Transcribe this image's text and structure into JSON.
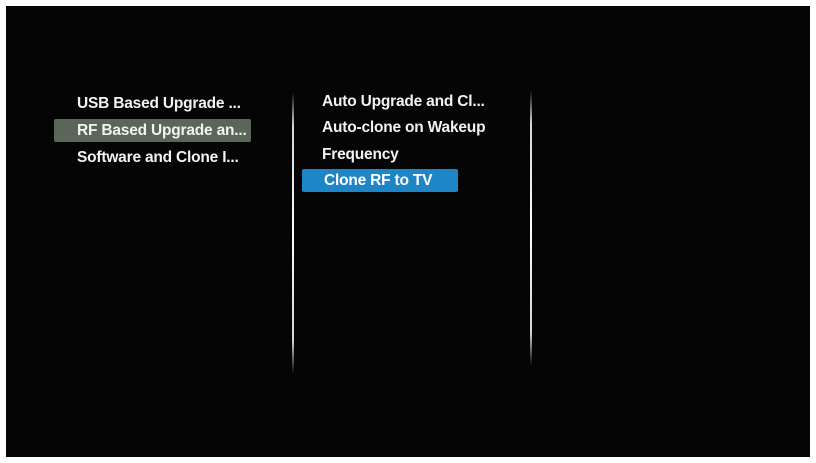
{
  "menu": {
    "left_items": [
      {
        "label": "USB Based Upgrade ...",
        "state": "normal"
      },
      {
        "label": "RF Based Upgrade an...",
        "state": "active"
      },
      {
        "label": "Software and Clone I...",
        "state": "normal"
      }
    ],
    "middle_items": [
      {
        "label": "Auto Upgrade and Cl...",
        "state": "normal"
      },
      {
        "label": "Auto-clone on Wakeup",
        "state": "normal"
      },
      {
        "label": "Frequency",
        "state": "normal"
      },
      {
        "label": "Clone RF to TV",
        "state": "selected"
      }
    ]
  },
  "colors": {
    "background": "#050505",
    "active_highlight": "#5a6758",
    "selection_highlight": "#1e86c6",
    "text": "#f2f2f2"
  }
}
